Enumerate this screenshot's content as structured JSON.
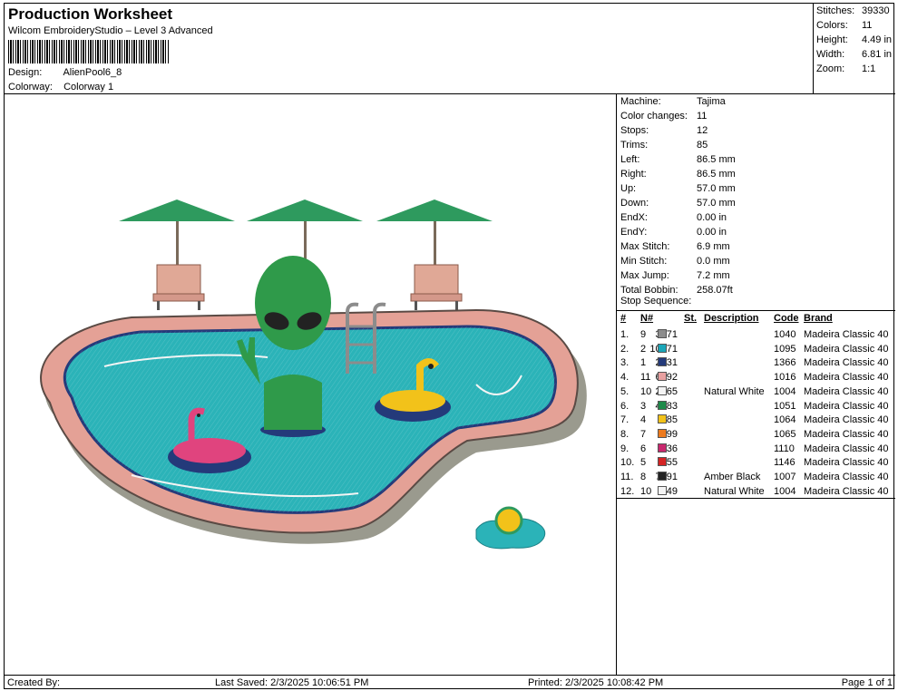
{
  "header": {
    "title": "Production Worksheet",
    "subtitle": "Wilcom EmbroideryStudio – Level 3 Advanced",
    "design_label": "Design:",
    "design_value": "AlienPool6_8",
    "colorway_label": "Colorway:",
    "colorway_value": "Colorway 1"
  },
  "summary": [
    {
      "label": "Stitches:",
      "value": "39330"
    },
    {
      "label": "Colors:",
      "value": "11"
    },
    {
      "label": "Height:",
      "value": "4.49 in"
    },
    {
      "label": "Width:",
      "value": "6.81 in"
    },
    {
      "label": "Zoom:",
      "value": "1:1"
    }
  ],
  "machine_info": [
    {
      "label": "Machine:",
      "value": "Tajima"
    },
    {
      "label": "Color changes:",
      "value": "11"
    },
    {
      "label": "Stops:",
      "value": "12"
    },
    {
      "label": "Trims:",
      "value": "85"
    },
    {
      "label": "Left:",
      "value": "86.5 mm"
    },
    {
      "label": "Right:",
      "value": "86.5 mm"
    },
    {
      "label": "Up:",
      "value": "57.0 mm"
    },
    {
      "label": "Down:",
      "value": "57.0 mm"
    },
    {
      "label": "EndX:",
      "value": "0.00 in"
    },
    {
      "label": "EndY:",
      "value": "0.00 in"
    },
    {
      "label": "Max Stitch:",
      "value": "6.9 mm"
    },
    {
      "label": "Min Stitch:",
      "value": "0.0 mm"
    },
    {
      "label": "Max Jump:",
      "value": "7.2 mm"
    },
    {
      "label": "Total Bobbin:",
      "value": "258.07ft"
    }
  ],
  "stop_sequence": {
    "heading": "Stop Sequence:",
    "columns": {
      "idx": "#",
      "n": "N#",
      "st": "St.",
      "desc": "Description",
      "code": "Code",
      "brand": "Brand"
    },
    "rows": [
      {
        "idx": "1.",
        "n": "9",
        "color": "#8c8c8c",
        "st": "3371",
        "desc": "",
        "code": "1040",
        "brand": "Madeira Classic 40"
      },
      {
        "idx": "2.",
        "n": "2",
        "color": "#1aa6b8",
        "st": "10671",
        "desc": "",
        "code": "1095",
        "brand": "Madeira Classic 40"
      },
      {
        "idx": "3.",
        "n": "1",
        "color": "#243a7a",
        "st": "2831",
        "desc": "",
        "code": "1366",
        "brand": "Madeira Classic 40"
      },
      {
        "idx": "4.",
        "n": "11",
        "color": "#e8a0a0",
        "st": "6392",
        "desc": "",
        "code": "1016",
        "brand": "Madeira Classic 40"
      },
      {
        "idx": "5.",
        "n": "10",
        "color": "#f4f4f4",
        "st": "2665",
        "desc": "Natural White",
        "code": "1004",
        "brand": "Madeira Classic 40"
      },
      {
        "idx": "6.",
        "n": "3",
        "color": "#1e8a4a",
        "st": "4083",
        "desc": "",
        "code": "1051",
        "brand": "Madeira Classic 40"
      },
      {
        "idx": "7.",
        "n": "4",
        "color": "#f2c21a",
        "st": "685",
        "desc": "",
        "code": "1064",
        "brand": "Madeira Classic 40"
      },
      {
        "idx": "8.",
        "n": "7",
        "color": "#ec7a1e",
        "st": "99",
        "desc": "",
        "code": "1065",
        "brand": "Madeira Classic 40"
      },
      {
        "idx": "9.",
        "n": "6",
        "color": "#c8286e",
        "st": "536",
        "desc": "",
        "code": "1110",
        "brand": "Madeira Classic 40"
      },
      {
        "idx": "10.",
        "n": "5",
        "color": "#d42424",
        "st": "55",
        "desc": "",
        "code": "1146",
        "brand": "Madeira Classic 40"
      },
      {
        "idx": "11.",
        "n": "8",
        "color": "#222222",
        "st": "7791",
        "desc": "Amber Black",
        "code": "1007",
        "brand": "Madeira Classic 40"
      },
      {
        "idx": "12.",
        "n": "10",
        "color": "#f4f4f4",
        "st": "149",
        "desc": "Natural White",
        "code": "1004",
        "brand": "Madeira Classic 40"
      }
    ]
  },
  "footer": {
    "created_by": "Created By:",
    "last_saved": "Last Saved: 2/3/2025 10:06:51 PM",
    "printed": "Printed: 2/3/2025 10:08:42 PM",
    "page": "Page 1 of 1"
  },
  "design_colors": {
    "pool_water": "#2bb3b8",
    "pool_rim": "#e4a196",
    "pool_shadow": "#9a9a8e",
    "umbrella": "#2e9a5e",
    "chair": "#e0a896",
    "alien": "#2f9a4a",
    "flamingo": "#e0447e",
    "duck_ring": "#f2c21a"
  }
}
